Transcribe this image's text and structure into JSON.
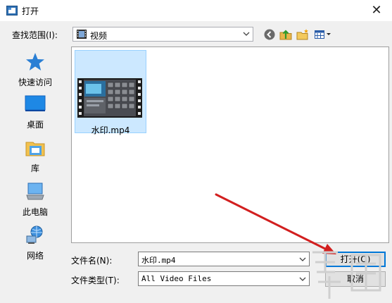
{
  "window": {
    "title": "打开",
    "close_icon": "close-icon"
  },
  "toolbar": {
    "lookin_label": "查找范围(I):",
    "lookin_value": "视频",
    "icons": [
      "back-icon",
      "up-folder-icon",
      "new-folder-icon",
      "view-menu-icon"
    ]
  },
  "places": [
    {
      "label": "快速访问",
      "icon": "star-icon"
    },
    {
      "label": "桌面",
      "icon": "desktop-icon"
    },
    {
      "label": "库",
      "icon": "library-icon"
    },
    {
      "label": "此电脑",
      "icon": "computer-icon"
    },
    {
      "label": "网络",
      "icon": "network-icon"
    }
  ],
  "files": [
    {
      "name": "水印.mp4",
      "icon": "video-thumbnail",
      "selected": true
    }
  ],
  "bottom": {
    "filename_label": "文件名(N):",
    "filename_value": "水印.mp4",
    "filetype_label": "文件类型(T):",
    "filetype_value": "All Video Files",
    "open_button": "打开(O)",
    "cancel_button": "取消"
  },
  "colors": {
    "selection_bg": "#cce8ff",
    "selection_border": "#99d1ff",
    "annotation_arrow": "#d21f1f",
    "default_button_border": "#0078d7"
  }
}
